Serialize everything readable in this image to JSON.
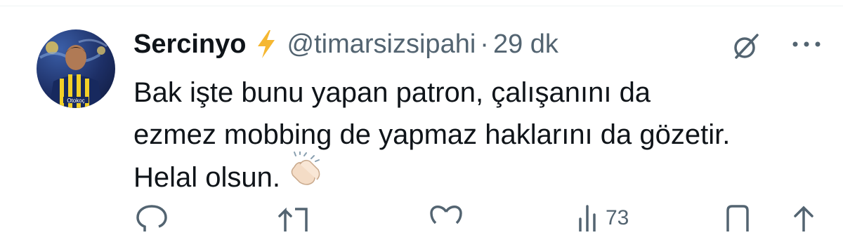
{
  "tweet": {
    "author": {
      "display_name": "Sercinyo",
      "handle": "@timarsizsipahi",
      "verified_badge_icon": "lightning-bolt-icon",
      "avatar_jersey_text": "Otokoç"
    },
    "separator": "·",
    "time": "29 dk",
    "text_lines": [
      "Bak işte bunu yapan patron, çalışanını da",
      "ezmez mobbing de yapmaz haklarını da gözetir.",
      "Helal olsun."
    ],
    "emoji_icon": "clapping-hands-icon",
    "header_icons": [
      "grok-icon",
      "more-icon"
    ],
    "actions": {
      "views_count": "73",
      "icons": [
        "reply-icon",
        "retweet-icon",
        "like-icon",
        "views-icon",
        "bookmark-icon",
        "share-icon"
      ]
    }
  },
  "colors": {
    "text_primary": "#0f1419",
    "text_secondary": "#536471",
    "bolt": "#f5b731",
    "background": "#ffffff"
  }
}
